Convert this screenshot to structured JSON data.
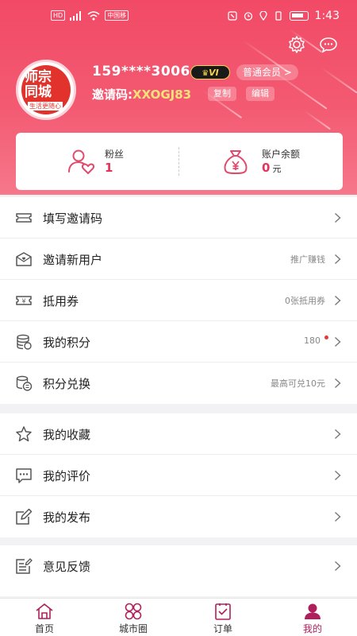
{
  "statusbar": {
    "chip1": "HD",
    "chip2": "中国移",
    "time": "1:43"
  },
  "profile": {
    "logo_text_line1": "师宗",
    "logo_text_line2": "同城",
    "logo_sub": "生活更随心",
    "phone": "159****3006",
    "vip_badge": "VI",
    "member_level": "普通会员 >",
    "invite_prefix": "邀请码:",
    "invite_code": "XXOGJ83",
    "copy_label": "复制",
    "edit_label": "编辑"
  },
  "stats": {
    "fans_label": "粉丝",
    "fans_value": "1",
    "balance_label": "账户余额",
    "balance_value": "0",
    "balance_unit": "元"
  },
  "menu_group1": [
    {
      "label": "填写邀请码",
      "hint": ""
    },
    {
      "label": "邀请新用户",
      "hint": "推广赚钱"
    },
    {
      "label": "抵用券",
      "hint": "0张抵用券"
    },
    {
      "label": "我的积分",
      "hint": "180"
    },
    {
      "label": "积分兑换",
      "hint": "最高可兑10元"
    }
  ],
  "menu_group2": [
    {
      "label": "我的收藏"
    },
    {
      "label": "我的评价"
    },
    {
      "label": "我的发布"
    }
  ],
  "menu_group3": [
    {
      "label": "意见反馈"
    }
  ],
  "tabs": [
    {
      "label": "首页",
      "icon": "home-icon"
    },
    {
      "label": "城市圈",
      "icon": "grid-icon"
    },
    {
      "label": "订单",
      "icon": "order-icon"
    },
    {
      "label": "我的",
      "icon": "profile-icon"
    }
  ],
  "colors": {
    "header": "#f24a66",
    "accent": "#e7335a",
    "active_tab": "#b01e5c",
    "invite_code": "#f7e27a"
  }
}
